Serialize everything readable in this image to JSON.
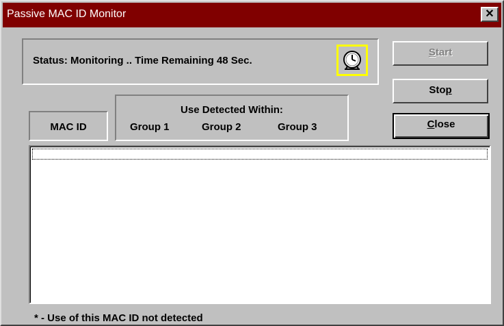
{
  "window": {
    "title": "Passive MAC ID Monitor",
    "close_glyph": "✕"
  },
  "status": {
    "text": "Status: Monitoring .. Time Remaining  48 Sec.",
    "icon": "alarm-clock-icon"
  },
  "buttons": {
    "start_pre": "",
    "start_mnemonic": "S",
    "start_post": "tart",
    "start_enabled": false,
    "stop_pre": "Sto",
    "stop_mnemonic": "p",
    "stop_post": "",
    "close_pre": "",
    "close_mnemonic": "C",
    "close_post": "lose"
  },
  "list_header": {
    "mac_id": "MAC ID",
    "use_detected": "Use Detected Within:",
    "groups": [
      "Group 1",
      "Group 2",
      "Group 3"
    ]
  },
  "list": {
    "rows": []
  },
  "footnote": "* - Use of this MAC ID not detected",
  "colors": {
    "titlebar": "#800000",
    "clock_highlight": "#ffff00",
    "face": "#c0c0c0"
  }
}
